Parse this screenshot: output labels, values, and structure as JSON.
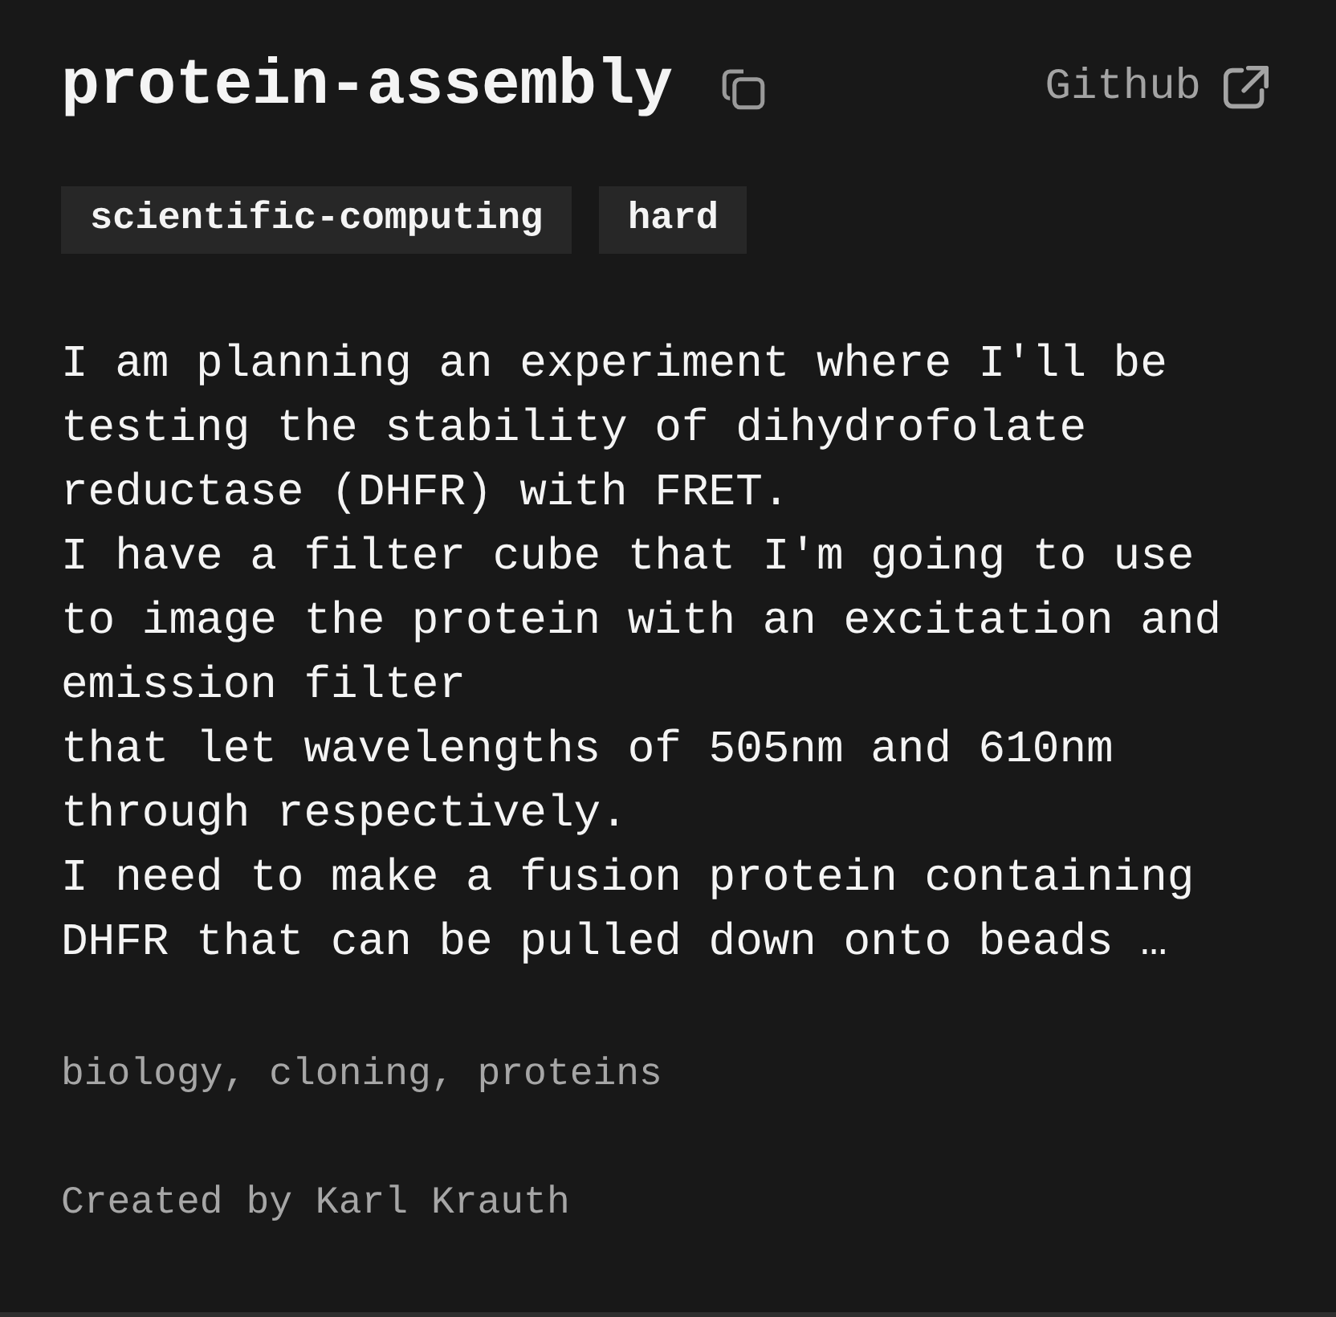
{
  "header": {
    "title": "protein-assembly",
    "link": "Github"
  },
  "tags": [
    {
      "label": "scientific-computing"
    },
    {
      "label": "hard"
    }
  ],
  "description": "I am planning an experiment where I'll be testing the stability of dihydrofolate reductase (DHFR) with FRET.\nI have a filter cube that I'm going to use to image the protein with an excitation and emission filter\nthat let wavelengths of 505nm and 610nm through respectively.\nI need to make a fusion protein containing DHFR that can be pulled down onto beads …",
  "keywords": "biology, cloning, proteins",
  "author": "Created by Karl Krauth"
}
